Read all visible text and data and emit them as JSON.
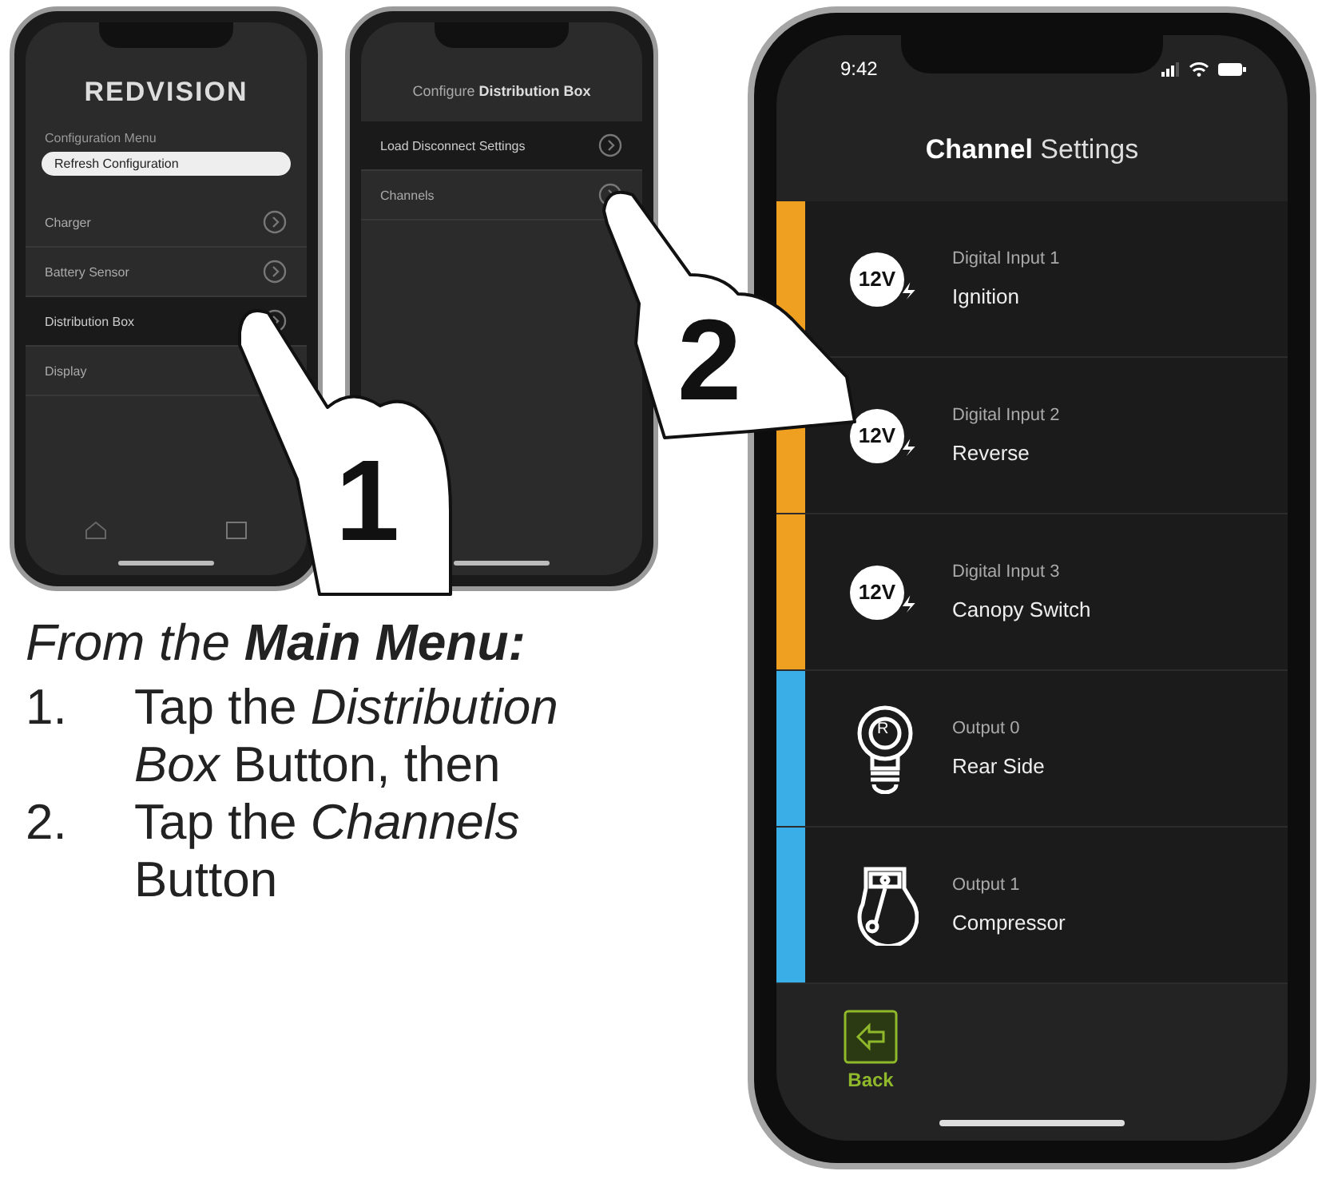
{
  "main_menu_screen": {
    "logo": "REDVISION",
    "section_label": "Configuration Menu",
    "refresh_button": "Refresh Configuration",
    "items": [
      {
        "label": "Charger",
        "selected": false
      },
      {
        "label": "Battery Sensor",
        "selected": false
      },
      {
        "label": "Distribution Box",
        "selected": true
      },
      {
        "label": "Display",
        "selected": false
      }
    ]
  },
  "distribution_screen": {
    "title": "Configure **Distribution Box**",
    "items": [
      {
        "label": "Load Disconnect Settings",
        "selected": true
      },
      {
        "label": "Channels",
        "selected": false
      }
    ]
  },
  "callouts": [
    "1",
    "2"
  ],
  "instructions": {
    "heading": "From the **Main Menu:**",
    "steps": [
      {
        "number": "1.",
        "text": "Tap the *Distribution Box* Button, then"
      },
      {
        "number": "2.",
        "text": "Tap the *Channels* Button"
      }
    ]
  },
  "channel_screen": {
    "time": "9:42",
    "title": "**Channel** Settings",
    "channels": [
      {
        "kind": "voltage",
        "badge": "12V",
        "label": "Digital Input 1",
        "name": "Ignition",
        "color": "#f0a020"
      },
      {
        "kind": "voltage",
        "badge": "12V",
        "label": "Digital Input 2",
        "name": "Reverse",
        "color": "#f0a020"
      },
      {
        "kind": "voltage",
        "badge": "12V",
        "label": "Digital Input 3",
        "name": "Canopy Switch",
        "color": "#f0a020"
      },
      {
        "kind": "bulb",
        "badge": "R",
        "label": "Output 0",
        "name": "Rear Side",
        "color": "#3aaee6"
      },
      {
        "kind": "compressor",
        "label": "Output 1",
        "name": "Compressor",
        "color": "#3aaee6"
      }
    ],
    "back_button": "Back"
  }
}
